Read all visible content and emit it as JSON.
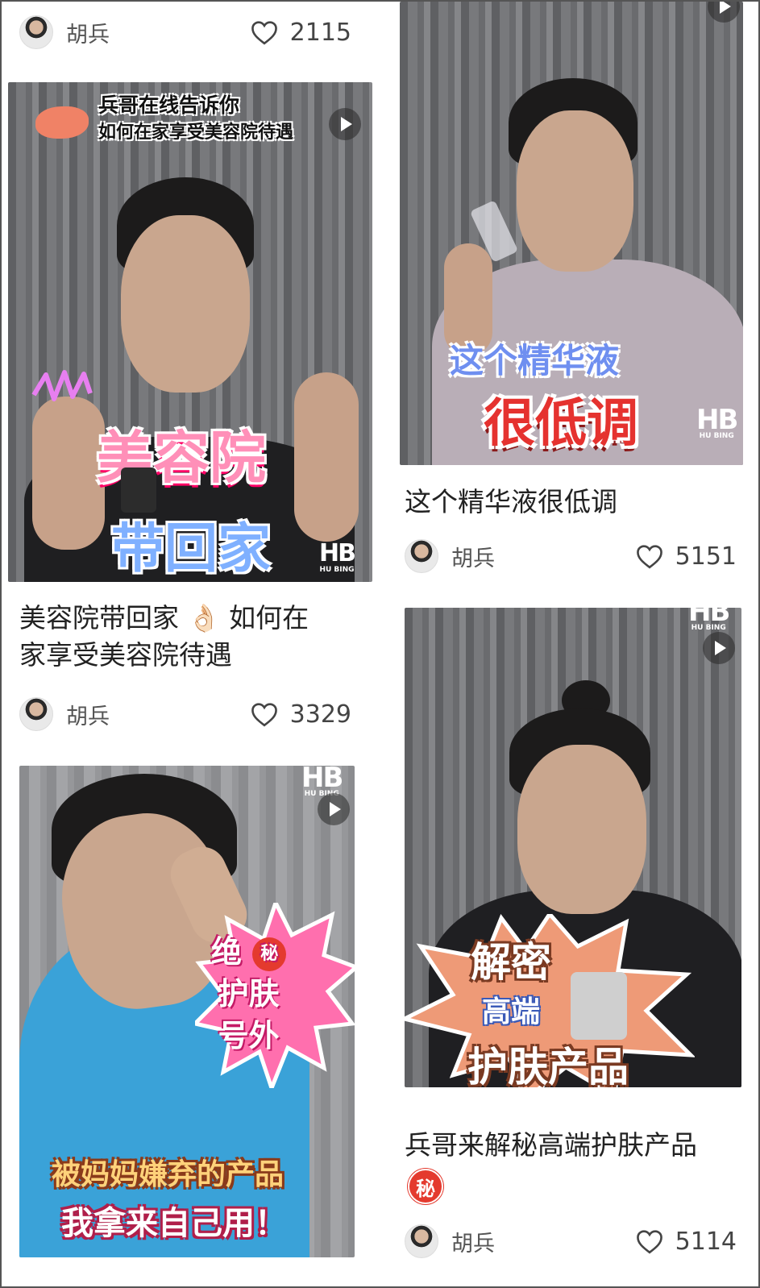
{
  "cards": [
    {
      "id": "c1",
      "author": "胡兵",
      "likes": "2115"
    },
    {
      "id": "c2",
      "overlay_top": [
        "兵哥在线告诉你",
        "如何在家享受美容院待遇"
      ],
      "overlay_big": "美容院",
      "overlay_big2": "带回家",
      "title_line1": "美容院带回家 👌🏻 如何在",
      "title_line2": "家享受美容院待遇",
      "author": "胡兵",
      "likes": "3329"
    },
    {
      "id": "c3",
      "overlay_top": "这个精华液",
      "overlay_big": "很低调",
      "title": "这个精华液很低调",
      "author": "胡兵",
      "likes": "5151"
    },
    {
      "id": "c4",
      "burst": [
        "绝",
        "秘",
        "护肤",
        "号外"
      ],
      "overlay_bottom1": "被妈妈嫌弃的产品",
      "overlay_bottom2": "我拿来自己用！",
      "logo": "HB",
      "logo_sub": "HU BING"
    },
    {
      "id": "c5",
      "burst": [
        "解密",
        "高端",
        "护肤产品"
      ],
      "title": "兵哥来解秘高端护肤产品",
      "badge": "秘",
      "author": "胡兵",
      "likes": "5114",
      "logo": "HB",
      "logo_sub": "HU BING"
    }
  ],
  "logo": "HB",
  "logo_sub": "HU BING",
  "colors": {
    "accent_red": "#e5322f",
    "pink": "#ff8fb8",
    "blue": "#7fb0ff",
    "text": "#222222",
    "muted": "#555555"
  }
}
